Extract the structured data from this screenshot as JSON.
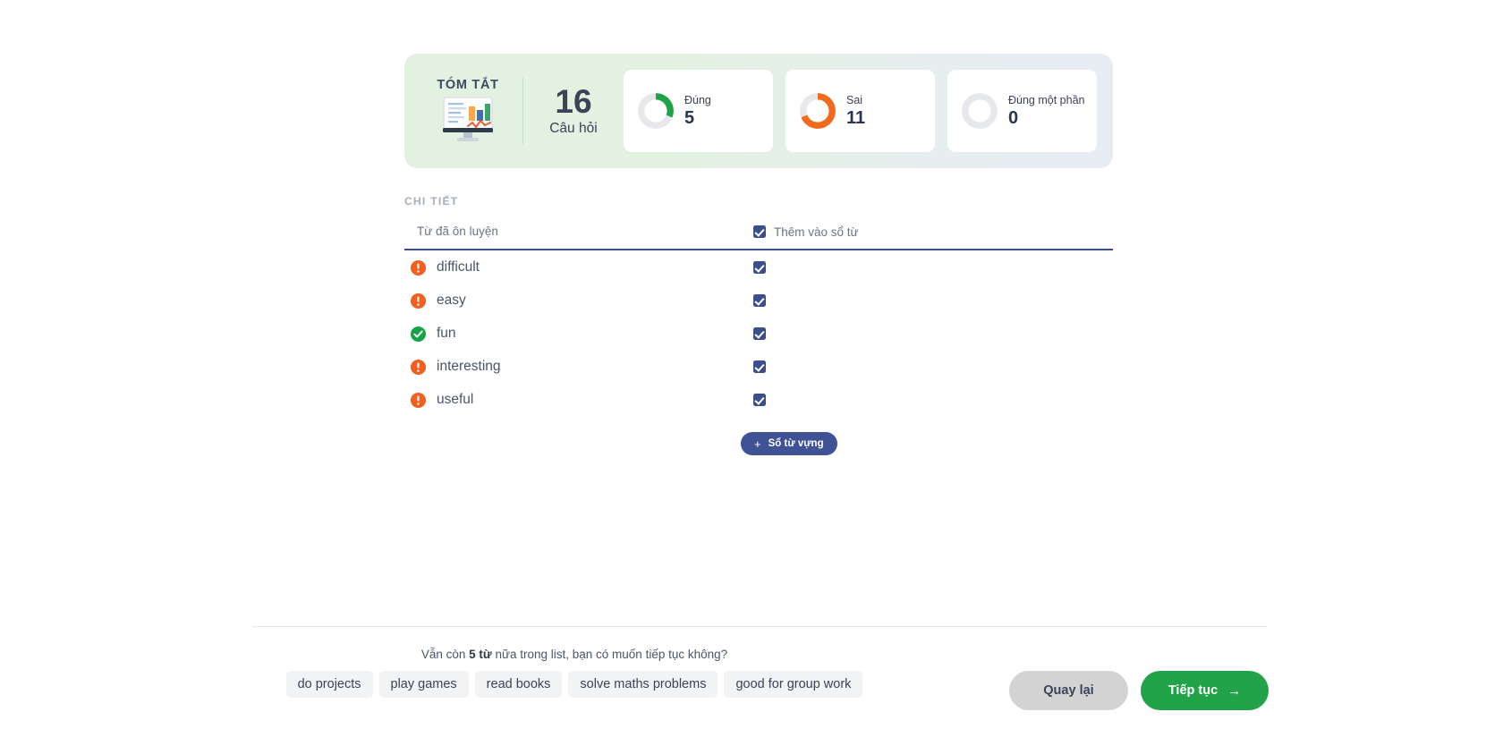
{
  "summary": {
    "brand_label": "TÓM TẮT",
    "brand_icon": "monitor-chart-icon",
    "total_value": "16",
    "total_label": "Câu hỏi",
    "stats": [
      {
        "label": "Đúng",
        "value": "5",
        "color": "#1ea34a",
        "percent": 31,
        "icon": "donut-correct-icon"
      },
      {
        "label": "Sai",
        "value": "11",
        "color": "#f26a1b",
        "percent": 69,
        "icon": "donut-wrong-icon"
      },
      {
        "label": "Đúng một phần",
        "value": "0",
        "color": "#e3e5e8",
        "percent": 0,
        "icon": "donut-partial-icon"
      }
    ],
    "track_color": "#e6e8eb",
    "panel_gradient_from": "#e3f1e1",
    "panel_gradient_to": "#e7edf2"
  },
  "detail": {
    "section_heading": "CHI TIẾT",
    "columns": {
      "word": "Từ đã ôn luyện",
      "add_to_notebook": "Thêm vào sổ từ"
    },
    "header_checkbox_checked": true,
    "rows": [
      {
        "word": "difficult",
        "status": "wrong",
        "status_icon": "error-exclamation-icon",
        "checked": true
      },
      {
        "word": "easy",
        "status": "wrong",
        "status_icon": "error-exclamation-icon",
        "checked": true
      },
      {
        "word": "fun",
        "status": "correct",
        "status_icon": "success-check-icon",
        "checked": true
      },
      {
        "word": "interesting",
        "status": "wrong",
        "status_icon": "error-exclamation-icon",
        "checked": true
      },
      {
        "word": "useful",
        "status": "wrong",
        "status_icon": "error-exclamation-icon",
        "checked": true
      }
    ],
    "status_colors": {
      "wrong": "#f1601f",
      "correct": "#16a34a"
    },
    "vocab_button": {
      "plus": "+",
      "label": "Sổ từ vựng",
      "color": "#3f5296"
    }
  },
  "footer": {
    "prompt_prefix": "Vẫn còn ",
    "prompt_strong": "5 từ",
    "prompt_suffix": " nữa trong list, bạn có muốn tiếp tục không?",
    "chips": [
      "do projects",
      "play games",
      "read books",
      "solve maths problems",
      "good for group work"
    ],
    "back_label": "Quay lại",
    "next_label": "Tiếp tục",
    "next_arrow": "→",
    "next_color": "#22a34a",
    "back_color": "#d3d3d3"
  }
}
